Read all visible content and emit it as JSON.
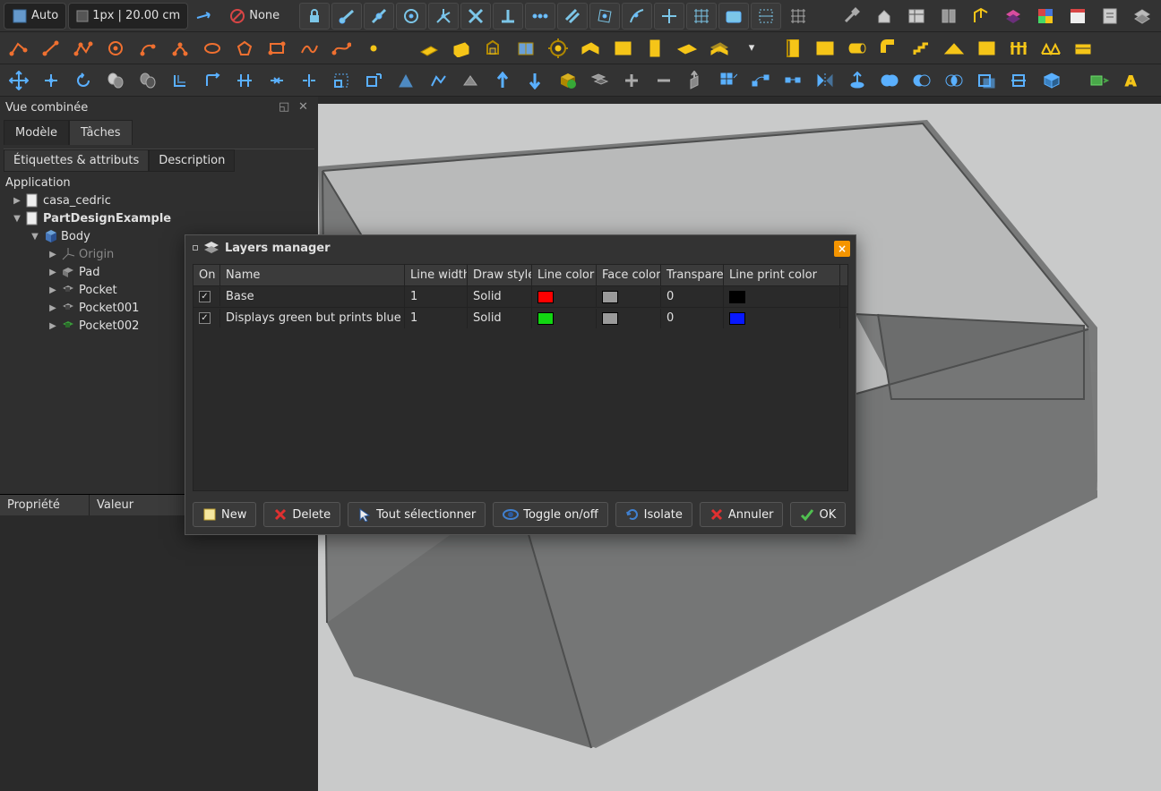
{
  "toolbar": {
    "auto": "Auto",
    "widthSpec": "1px | 20.00 cm",
    "none": "None"
  },
  "panel": {
    "title": "Vue combinée",
    "tabs": {
      "model": "Modèle",
      "tasks": "Tâches"
    },
    "subtabs": {
      "labels": "Étiquettes & attributs",
      "desc": "Description"
    },
    "tree": {
      "app": "Application",
      "doc1": "casa_cedric",
      "doc2": "PartDesignExample",
      "body": "Body",
      "origin": "Origin",
      "pad": "Pad",
      "pocket": "Pocket",
      "pocket1": "Pocket001",
      "pocket2": "Pocket002"
    },
    "prop": {
      "property": "Propriété",
      "value": "Valeur"
    }
  },
  "dialog": {
    "title": "Layers manager",
    "headers": {
      "on": "On",
      "name": "Name",
      "lineWidth": "Line width",
      "drawStyle": "Draw style",
      "lineColor": "Line color",
      "faceColor": "Face color",
      "transparency": "Transparency",
      "linePrintColor": "Line print color"
    },
    "rows": [
      {
        "on": true,
        "name": "Base",
        "lineWidth": "1",
        "drawStyle": "Solid",
        "lineColor": "#ff0000",
        "faceColor": "#9a9a9a",
        "transparency": "0",
        "linePrintColor": "#000000"
      },
      {
        "on": true,
        "name": "Displays green but prints blue",
        "lineWidth": "1",
        "drawStyle": "Solid",
        "lineColor": "#12d612",
        "faceColor": "#9a9a9a",
        "transparency": "0",
        "linePrintColor": "#0818ff"
      }
    ],
    "buttons": {
      "new": "New",
      "delete": "Delete",
      "selectAll": "Tout sélectionner",
      "toggle": "Toggle on/off",
      "isolate": "Isolate",
      "cancel": "Annuler",
      "ok": "OK"
    }
  }
}
